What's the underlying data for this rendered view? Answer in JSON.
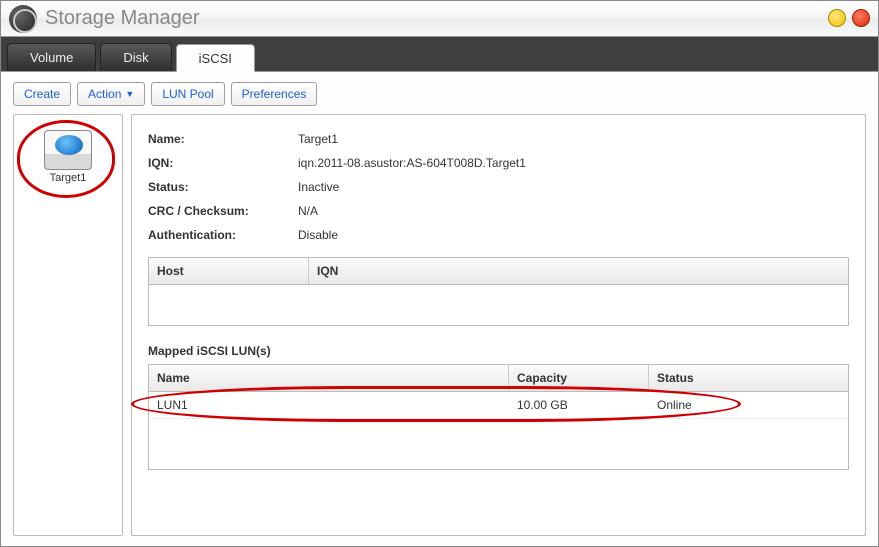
{
  "window": {
    "title": "Storage Manager"
  },
  "tabs": {
    "volume": "Volume",
    "disk": "Disk",
    "iscsi": "iSCSI"
  },
  "toolbar": {
    "create": "Create",
    "action": "Action",
    "lun_pool": "LUN Pool",
    "preferences": "Preferences"
  },
  "sidebar": {
    "target_label": "Target1"
  },
  "details": {
    "labels": {
      "name": "Name:",
      "iqn": "IQN:",
      "status": "Status:",
      "crc": "CRC / Checksum:",
      "auth": "Authentication:"
    },
    "values": {
      "name": "Target1",
      "iqn": "iqn.2011-08.asustor:AS-604T008D.Target1",
      "status": "Inactive",
      "crc": "N/A",
      "auth": "Disable"
    }
  },
  "host_table": {
    "headers": {
      "host": "Host",
      "iqn": "IQN"
    }
  },
  "lun_section": {
    "title": "Mapped iSCSI LUN(s)",
    "headers": {
      "name": "Name",
      "capacity": "Capacity",
      "status": "Status"
    },
    "row": {
      "name": "LUN1",
      "capacity": "10.00 GB",
      "status": "Online"
    }
  }
}
